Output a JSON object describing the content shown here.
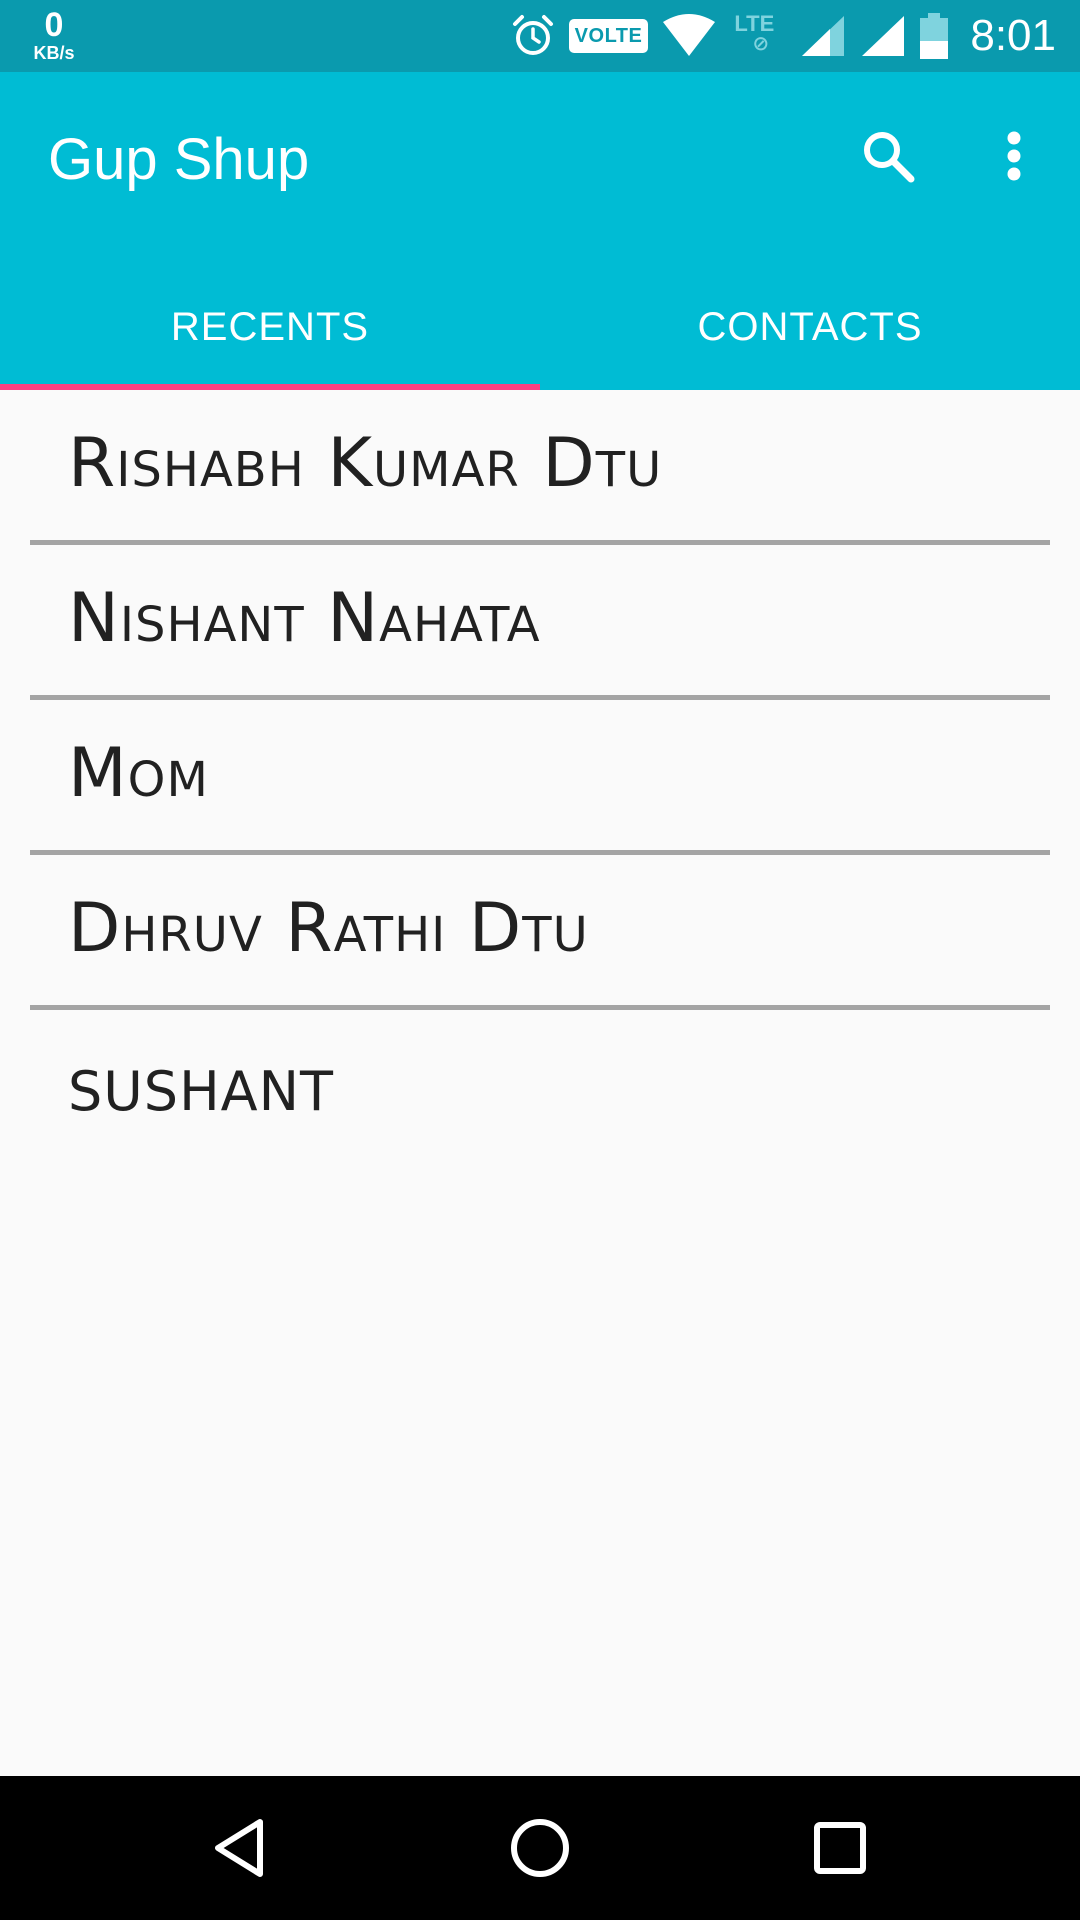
{
  "status_bar": {
    "net_speed_value": "0",
    "net_speed_unit": "KB/s",
    "volte_label": "VOLTE",
    "lte_label": "LTE",
    "time": "8:01",
    "icons": [
      "alarm-icon",
      "volte-icon",
      "wifi-icon",
      "lte-icon",
      "signal-icon",
      "signal-icon",
      "battery-icon"
    ]
  },
  "app_bar": {
    "title": "Gup Shup",
    "actions": [
      "search-icon",
      "more-vert-icon"
    ]
  },
  "tabs": [
    {
      "label": "RECENTS",
      "selected": true
    },
    {
      "label": "CONTACTS",
      "selected": false
    }
  ],
  "recents": [
    {
      "name": "Rishabh Kumar Dtu"
    },
    {
      "name": "Nishant Nahata"
    },
    {
      "name": "Mom"
    },
    {
      "name": "Dhruv Rathi Dtu"
    },
    {
      "name": "SUSHANT"
    }
  ],
  "colors": {
    "status_bar": "#0a9aae",
    "primary": "#00bcd4",
    "accent": "#ff4081",
    "background": "#fafafa",
    "text": "#212121",
    "divider": "#a4a4a4"
  },
  "nav_bar": [
    "back-icon",
    "home-icon",
    "recent-apps-icon"
  ]
}
